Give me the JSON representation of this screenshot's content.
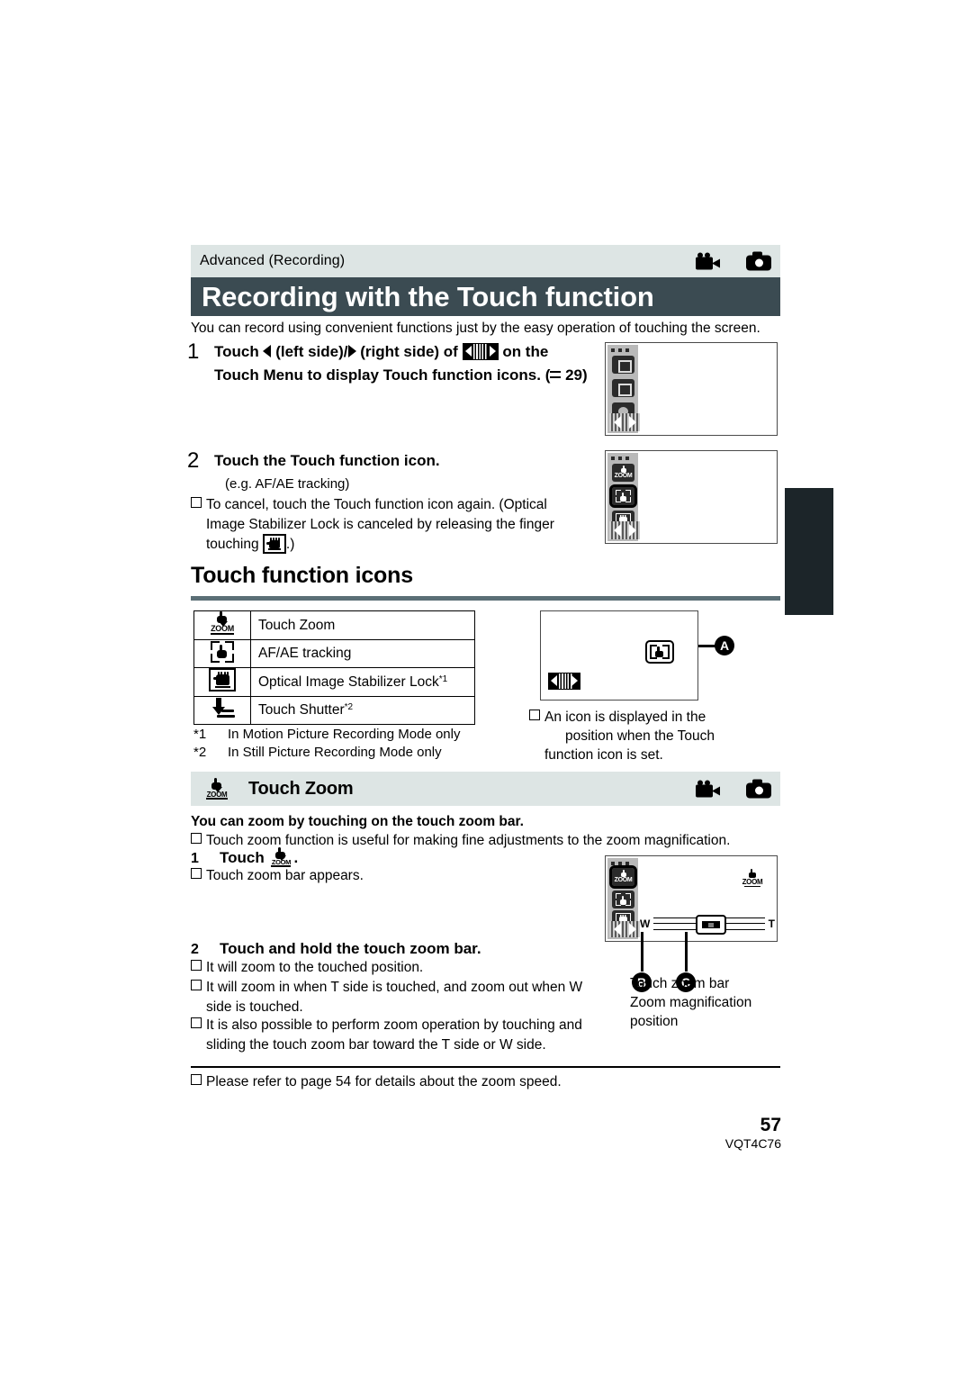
{
  "header": {
    "breadcrumb": "Advanced (Recording)",
    "title": "Recording with the Touch function",
    "mode_icons": [
      "video-camera-icon",
      "still-camera-icon"
    ]
  },
  "intro": "You can record using convenient functions just by the easy operation of touching the screen.",
  "steps": [
    {
      "number": "1",
      "text_a": "Touch",
      "text_b": "(left side)/",
      "text_c": "(right side) of",
      "text_d": "on the Touch Menu to display Touch function icons. (",
      "page_ref": "29",
      "text_e": ")"
    },
    {
      "number": "2",
      "text": "Touch the Touch function icon.",
      "example": "(e.g. AF/AE tracking)"
    }
  ],
  "cancel_note": {
    "line1": "To cancel, touch the Touch function icon again. (Optical",
    "line2": "Image Stabilizer Lock is canceled by releasing the finger",
    "line3_pre": "touching",
    "line3_post": ".)"
  },
  "section": {
    "heading": "Touch function icons",
    "table": {
      "rows": [
        {
          "icon": "touch-zoom-icon",
          "label": "Touch Zoom",
          "note": ""
        },
        {
          "icon": "af-ae-tracking-icon",
          "label": "AF/AE tracking",
          "note": ""
        },
        {
          "icon": "ois-lock-icon",
          "label": "Optical Image Stabilizer Lock",
          "note": "*1"
        },
        {
          "icon": "touch-shutter-icon",
          "label": "Touch Shutter",
          "note": "*2"
        }
      ]
    },
    "footnotes": [
      {
        "key": "*1",
        "text": "In Motion Picture Recording Mode only"
      },
      {
        "key": "*2",
        "text": "In Still Picture Recording Mode only"
      }
    ]
  },
  "illustration_a": {
    "callout": "A",
    "caption_l1": "An icon is displayed in the",
    "caption_l2": "position when the Touch",
    "caption_l3": "function icon is set."
  },
  "touch_zoom": {
    "bar_icon": "touch-zoom-icon",
    "heading": "Touch Zoom",
    "mode_icons": [
      "video-camera-icon",
      "still-camera-icon"
    ],
    "lead": "You can zoom by touching on the touch zoom bar.",
    "useful_note": "Touch zoom function is useful for making fine adjustments to the zoom magnification.",
    "step1": {
      "number": "1",
      "text": "Touch",
      "trailing": "."
    },
    "step1_note": "Touch zoom bar appears.",
    "step2": {
      "number": "2",
      "text": "Touch and hold the touch zoom bar."
    },
    "step2_notes": [
      "It will zoom to the touched position.",
      "It will zoom in when T side is touched, and zoom out when W side is touched.",
      "It is also possible to perform zoom operation by touching and sliding the touch zoom bar toward the T side or W side."
    ],
    "step2_notes_wrapped": [
      {
        "l1": "It will zoom to the touched position."
      },
      {
        "l1": "It will zoom in when T side is touched, and zoom out when W",
        "l2": "side is touched."
      },
      {
        "l1": "It is also possible to perform zoom operation by touching and",
        "l2": "sliding the touch zoom bar toward the T side or W side."
      }
    ],
    "illustration": {
      "w_label": "W",
      "t_label": "T",
      "callout_b": "B",
      "callout_c": "C",
      "caption_b_l1": "Touch zoom bar",
      "caption_b_l2": "Zoom magnification",
      "caption_b_l3": "position"
    }
  },
  "speed_note": "Please refer to page 54 for details about the zoom speed.",
  "footer": {
    "page_number": "57",
    "doc_code": "VQT4C76"
  },
  "colors": {
    "title_bar": "#3b4b52",
    "strip": "#dde5e4",
    "rule": "#5b6f76",
    "tab": "#1c2529"
  }
}
